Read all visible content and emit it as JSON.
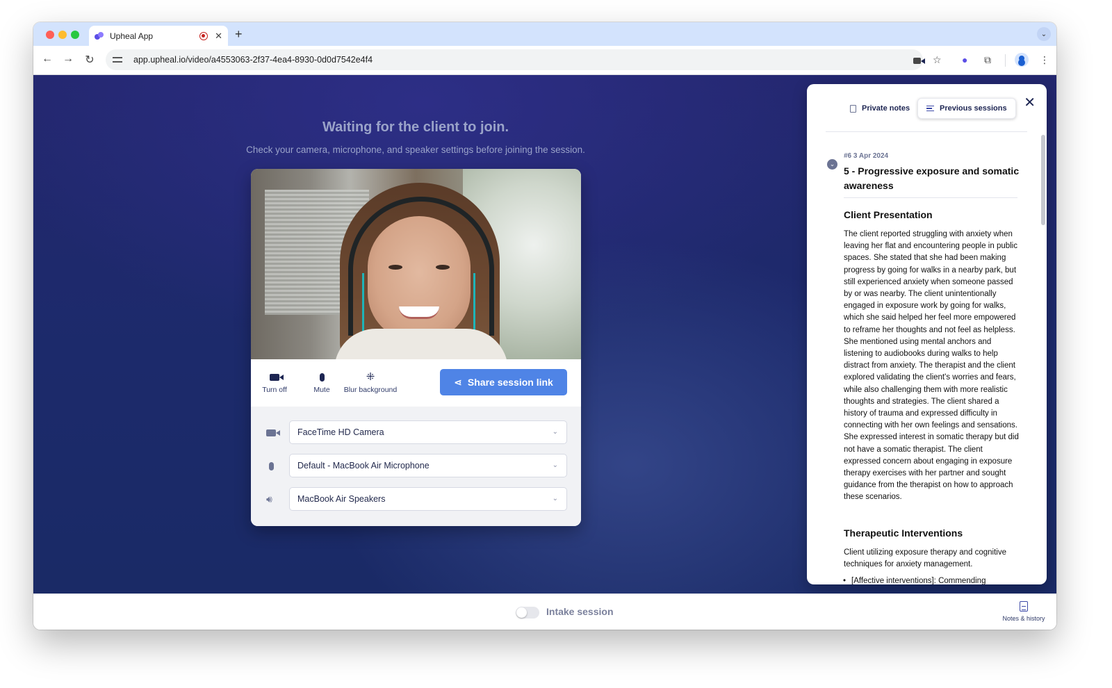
{
  "browser": {
    "tab_title": "Upheal App",
    "tab_close": "✕",
    "new_tab": "+",
    "tab_menu": "⌄",
    "url": "app.upheal.io/video/a4553063-2f37-4ea4-8930-0d0d7542e4f4",
    "back": "←",
    "forward": "→",
    "reload": "↻",
    "icons": [
      "video-camera-icon",
      "star-icon",
      "upheal-extension-icon",
      "puzzle-extension-icon",
      "profile-icon",
      "kebab-menu-icon"
    ]
  },
  "waiting": {
    "title": "Waiting for the client to join.",
    "subtitle": "Check your camera, microphone, and speaker settings before joining the session."
  },
  "controls": {
    "camera_label": "Turn off",
    "mic_label": "Mute",
    "blur_label": "Blur background",
    "share_label": "Share session link"
  },
  "devices": {
    "camera": "FaceTime HD Camera",
    "microphone": "Default - MacBook Air Microphone",
    "speakers": "MacBook Air Speakers"
  },
  "panel": {
    "tab_private": "Private notes",
    "tab_previous": "Previous sessions",
    "active_tab": "Previous sessions",
    "close": "✕",
    "session": {
      "meta": "#6 3 Apr 2024",
      "title": "5 - Progressive exposure and somatic awareness",
      "sections": [
        {
          "title": "Client Presentation",
          "body": "The client reported struggling with anxiety when leaving her flat and encountering people in public spaces. She stated that she had been making progress by going for walks in a nearby park, but still experienced anxiety when someone passed by or was nearby. The client unintentionally engaged in exposure work by going for walks, which she said helped her feel more empowered to reframe her thoughts and not feel as helpless. She mentioned using mental anchors and listening to audiobooks during walks to help distract from anxiety. The therapist and the client explored validating the client's worries and fears, while also challenging them with more realistic thoughts and strategies. The client shared a history of trauma and expressed difficulty in connecting with her own feelings and sensations. She expressed interest in somatic therapy but did not have a somatic therapist. The client expressed concern about engaging in exposure therapy exercises with her partner and sought guidance from the therapist on how to approach these scenarios."
        },
        {
          "title": "Therapeutic Interventions",
          "body": "Client utilizing exposure therapy and cognitive techniques for anxiety management.",
          "bullets": [
            "[Affective interventions]: Commending"
          ]
        }
      ]
    }
  },
  "bottom": {
    "intake_label": "Intake session",
    "intake_on": false,
    "notes_history_label": "Notes & history"
  }
}
